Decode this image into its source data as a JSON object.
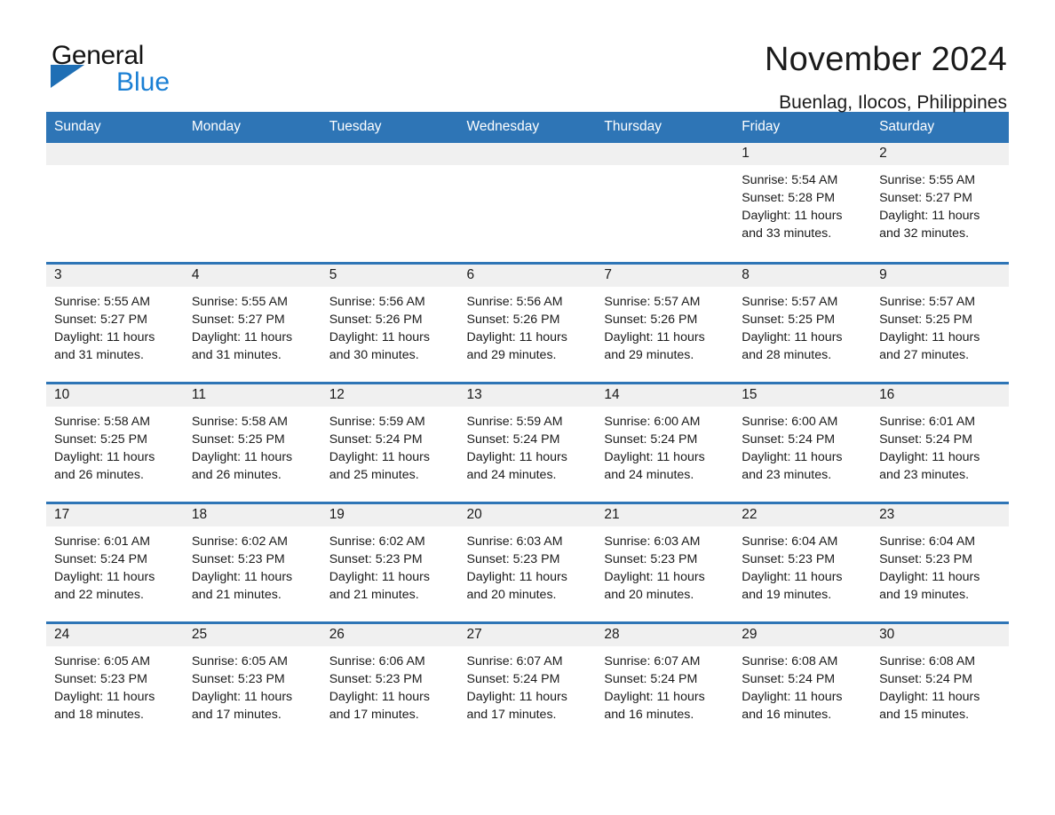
{
  "logo": {
    "word1": "General",
    "word2": "Blue",
    "triangle_color": "#1f6fb5",
    "blue_text_color": "#1a7fd4"
  },
  "header": {
    "title": "November 2024",
    "location": "Buenlag, Ilocos, Philippines"
  },
  "theme": {
    "header_blue": "#2e75b6",
    "daynum_band": "#f0f0f0",
    "text": "#1a1a1a"
  },
  "weekdays": [
    "Sunday",
    "Monday",
    "Tuesday",
    "Wednesday",
    "Thursday",
    "Friday",
    "Saturday"
  ],
  "weeks": [
    [
      {
        "day": "",
        "lines": []
      },
      {
        "day": "",
        "lines": []
      },
      {
        "day": "",
        "lines": []
      },
      {
        "day": "",
        "lines": []
      },
      {
        "day": "",
        "lines": []
      },
      {
        "day": "1",
        "lines": [
          "Sunrise: 5:54 AM",
          "Sunset: 5:28 PM",
          "Daylight: 11 hours",
          "and 33 minutes."
        ]
      },
      {
        "day": "2",
        "lines": [
          "Sunrise: 5:55 AM",
          "Sunset: 5:27 PM",
          "Daylight: 11 hours",
          "and 32 minutes."
        ]
      }
    ],
    [
      {
        "day": "3",
        "lines": [
          "Sunrise: 5:55 AM",
          "Sunset: 5:27 PM",
          "Daylight: 11 hours",
          "and 31 minutes."
        ]
      },
      {
        "day": "4",
        "lines": [
          "Sunrise: 5:55 AM",
          "Sunset: 5:27 PM",
          "Daylight: 11 hours",
          "and 31 minutes."
        ]
      },
      {
        "day": "5",
        "lines": [
          "Sunrise: 5:56 AM",
          "Sunset: 5:26 PM",
          "Daylight: 11 hours",
          "and 30 minutes."
        ]
      },
      {
        "day": "6",
        "lines": [
          "Sunrise: 5:56 AM",
          "Sunset: 5:26 PM",
          "Daylight: 11 hours",
          "and 29 minutes."
        ]
      },
      {
        "day": "7",
        "lines": [
          "Sunrise: 5:57 AM",
          "Sunset: 5:26 PM",
          "Daylight: 11 hours",
          "and 29 minutes."
        ]
      },
      {
        "day": "8",
        "lines": [
          "Sunrise: 5:57 AM",
          "Sunset: 5:25 PM",
          "Daylight: 11 hours",
          "and 28 minutes."
        ]
      },
      {
        "day": "9",
        "lines": [
          "Sunrise: 5:57 AM",
          "Sunset: 5:25 PM",
          "Daylight: 11 hours",
          "and 27 minutes."
        ]
      }
    ],
    [
      {
        "day": "10",
        "lines": [
          "Sunrise: 5:58 AM",
          "Sunset: 5:25 PM",
          "Daylight: 11 hours",
          "and 26 minutes."
        ]
      },
      {
        "day": "11",
        "lines": [
          "Sunrise: 5:58 AM",
          "Sunset: 5:25 PM",
          "Daylight: 11 hours",
          "and 26 minutes."
        ]
      },
      {
        "day": "12",
        "lines": [
          "Sunrise: 5:59 AM",
          "Sunset: 5:24 PM",
          "Daylight: 11 hours",
          "and 25 minutes."
        ]
      },
      {
        "day": "13",
        "lines": [
          "Sunrise: 5:59 AM",
          "Sunset: 5:24 PM",
          "Daylight: 11 hours",
          "and 24 minutes."
        ]
      },
      {
        "day": "14",
        "lines": [
          "Sunrise: 6:00 AM",
          "Sunset: 5:24 PM",
          "Daylight: 11 hours",
          "and 24 minutes."
        ]
      },
      {
        "day": "15",
        "lines": [
          "Sunrise: 6:00 AM",
          "Sunset: 5:24 PM",
          "Daylight: 11 hours",
          "and 23 minutes."
        ]
      },
      {
        "day": "16",
        "lines": [
          "Sunrise: 6:01 AM",
          "Sunset: 5:24 PM",
          "Daylight: 11 hours",
          "and 23 minutes."
        ]
      }
    ],
    [
      {
        "day": "17",
        "lines": [
          "Sunrise: 6:01 AM",
          "Sunset: 5:24 PM",
          "Daylight: 11 hours",
          "and 22 minutes."
        ]
      },
      {
        "day": "18",
        "lines": [
          "Sunrise: 6:02 AM",
          "Sunset: 5:23 PM",
          "Daylight: 11 hours",
          "and 21 minutes."
        ]
      },
      {
        "day": "19",
        "lines": [
          "Sunrise: 6:02 AM",
          "Sunset: 5:23 PM",
          "Daylight: 11 hours",
          "and 21 minutes."
        ]
      },
      {
        "day": "20",
        "lines": [
          "Sunrise: 6:03 AM",
          "Sunset: 5:23 PM",
          "Daylight: 11 hours",
          "and 20 minutes."
        ]
      },
      {
        "day": "21",
        "lines": [
          "Sunrise: 6:03 AM",
          "Sunset: 5:23 PM",
          "Daylight: 11 hours",
          "and 20 minutes."
        ]
      },
      {
        "day": "22",
        "lines": [
          "Sunrise: 6:04 AM",
          "Sunset: 5:23 PM",
          "Daylight: 11 hours",
          "and 19 minutes."
        ]
      },
      {
        "day": "23",
        "lines": [
          "Sunrise: 6:04 AM",
          "Sunset: 5:23 PM",
          "Daylight: 11 hours",
          "and 19 minutes."
        ]
      }
    ],
    [
      {
        "day": "24",
        "lines": [
          "Sunrise: 6:05 AM",
          "Sunset: 5:23 PM",
          "Daylight: 11 hours",
          "and 18 minutes."
        ]
      },
      {
        "day": "25",
        "lines": [
          "Sunrise: 6:05 AM",
          "Sunset: 5:23 PM",
          "Daylight: 11 hours",
          "and 17 minutes."
        ]
      },
      {
        "day": "26",
        "lines": [
          "Sunrise: 6:06 AM",
          "Sunset: 5:23 PM",
          "Daylight: 11 hours",
          "and 17 minutes."
        ]
      },
      {
        "day": "27",
        "lines": [
          "Sunrise: 6:07 AM",
          "Sunset: 5:24 PM",
          "Daylight: 11 hours",
          "and 17 minutes."
        ]
      },
      {
        "day": "28",
        "lines": [
          "Sunrise: 6:07 AM",
          "Sunset: 5:24 PM",
          "Daylight: 11 hours",
          "and 16 minutes."
        ]
      },
      {
        "day": "29",
        "lines": [
          "Sunrise: 6:08 AM",
          "Sunset: 5:24 PM",
          "Daylight: 11 hours",
          "and 16 minutes."
        ]
      },
      {
        "day": "30",
        "lines": [
          "Sunrise: 6:08 AM",
          "Sunset: 5:24 PM",
          "Daylight: 11 hours",
          "and 15 minutes."
        ]
      }
    ]
  ]
}
